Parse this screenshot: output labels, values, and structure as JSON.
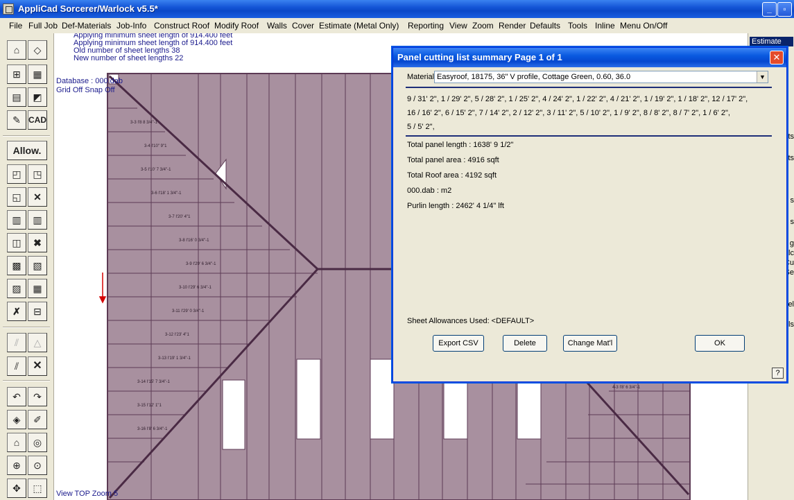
{
  "window": {
    "title": "AppliCad Sorcerer/Warlock v5.5*",
    "controls": [
      "_",
      "▫",
      "×"
    ]
  },
  "menu": [
    "File",
    "Full Job",
    "Def-Materials",
    "Job-Info",
    "Construct Roof",
    "Modify Roof",
    "Walls",
    "Cover",
    "Estimate (Metal Only)",
    "Reporting",
    "View",
    "Zoom",
    "Render",
    "Defaults",
    "Tools",
    "Inline",
    "Menu On/Off"
  ],
  "messages": {
    "line0": "Applying minimum sheet length of 914.400 feet",
    "line1": "Applying minimum sheet length of 914.400 feet",
    "line2": "Old number of sheet lengths 38",
    "line3": "New number of sheet lengths 22"
  },
  "status": {
    "database": "Database : 000.dab",
    "grid": "Grid Off  Snap Off",
    "view": "View TOP  Zoom 5"
  },
  "toolbar": {
    "allow_label": "Allow.",
    "cad_label": "CAD"
  },
  "right_panel": {
    "estimate_tab": "Estimate",
    "fragments": [
      "ts",
      "ts",
      "s",
      "s",
      "g",
      "alc",
      "Cu",
      "Se",
      "el",
      "els"
    ]
  },
  "dialog": {
    "title": "Panel cutting list summary Page 1 of 1",
    "material_label": "Material:",
    "material_value": "Easyroof, 18175, 36\" V profile, Cottage Green, 0.60, 36.0",
    "cut_lines": [
      "9 / 31' 2\",  1 / 29' 2\",  5 / 28' 2\",  1 / 25' 2\",  4 / 24' 2\",  1 / 22' 2\",  4 / 21' 2\",  1 / 19' 2\",  1 / 18' 2\",  12 / 17' 2\",",
      "16 / 16' 2\",  6 / 15' 2\",  7 / 14' 2\",  2 / 12' 2\",  3 / 11' 2\",  5 / 10' 2\",  1 / 9' 2\",  8 / 8' 2\",  8 / 7' 2\",  1 / 6' 2\",",
      "5 / 5' 2\","
    ],
    "total_panel_length": "Total panel length : 1638' 9 1/2\"",
    "total_panel_area": "Total panel area : 4916 sqft",
    "total_roof_area": "Total Roof area : 4192 sqft",
    "db_units": "000.dab : m2",
    "purlin_length": "Purlin length : 2462' 4 1/4\" lft",
    "allowances": "Sheet Allowances Used: <DEFAULT>",
    "buttons": {
      "export": "Export CSV",
      "delete": "Delete",
      "change": "Change Mat'l",
      "ok": "OK",
      "help": "?"
    }
  },
  "colors": {
    "roof_fill": "#a8909f",
    "roof_line": "#5c3a54",
    "ridge_line": "#4a2a44",
    "titlebar": "#0a5ae0",
    "arrow": "#d40000"
  }
}
